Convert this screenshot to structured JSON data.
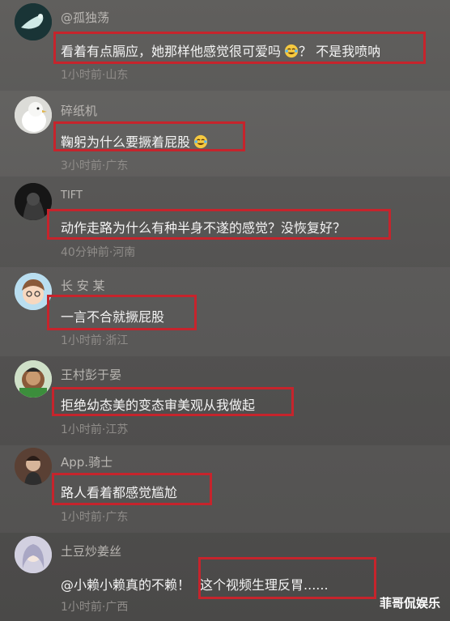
{
  "comments": [
    {
      "user": "@孤独荡",
      "text": "看着有点膈应，她那样他感觉很可爱吗",
      "text_after": "？ 不是我喷呐",
      "meta": "1小时前·山东",
      "emoji": "laughing-crying-emoji"
    },
    {
      "user": "碎纸机",
      "text": "鞠躬为什么要撅着屁股",
      "meta": "3小时前·广东",
      "emoji": "laughing-crying-emoji"
    },
    {
      "user": "TIFT",
      "text": "动作走路为什么有种半身不遂的感觉？没恢复好？",
      "meta": "40分钟前·河南"
    },
    {
      "user": "长 安 某",
      "text": "一言不合就撅屁股",
      "meta": "1小时前·浙江"
    },
    {
      "user": "王村彭于晏",
      "text": "拒绝幼态美的变态审美观从我做起",
      "meta": "1小时前·江苏"
    },
    {
      "user": "App.骑士",
      "text": "路人看着都感觉尴尬",
      "meta": "1小时前·广东"
    },
    {
      "user": "土豆炒姜丝",
      "mention": "@小赖小赖真的不赖！",
      "text": "这个视频生理反胃......",
      "meta": "1小时前·广西"
    }
  ],
  "watermark": "菲哥侃娱乐",
  "colors": {
    "highlight": "#c6242c",
    "username": "#b9b6b2",
    "meta": "#8f8c89",
    "text": "#f4f4f4"
  }
}
